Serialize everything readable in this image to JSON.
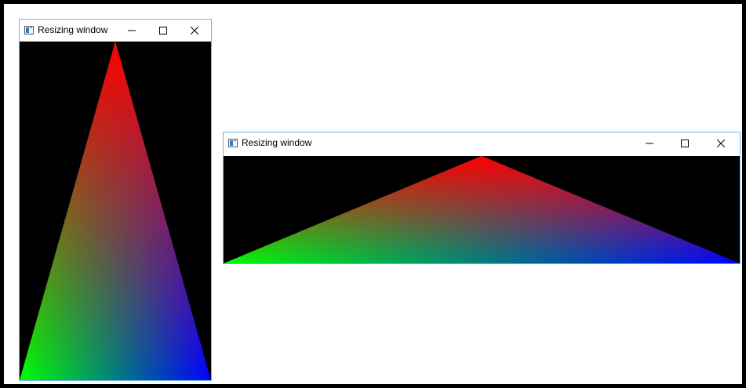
{
  "windows": [
    {
      "title": "Resizing window"
    },
    {
      "title": "Resizing window"
    }
  ],
  "triangle": {
    "top_color": "#ff0000",
    "bottom_left_color": "#00ff00",
    "bottom_right_color": "#0000ff",
    "background": "#000000"
  },
  "icons": {
    "app": "app-window-icon",
    "minimize": "minimize-icon",
    "maximize": "maximize-icon",
    "close": "close-icon"
  }
}
